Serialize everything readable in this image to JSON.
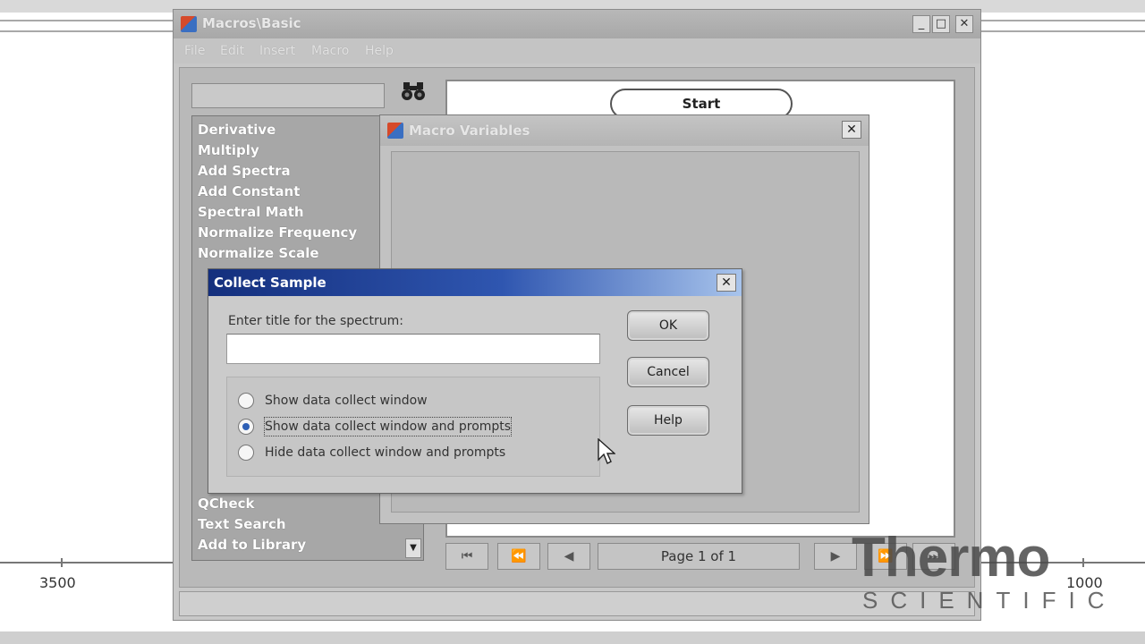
{
  "background": {
    "axis_labels": [
      "3500",
      "1000"
    ]
  },
  "main_window": {
    "title": "Macros\\Basic",
    "controls": {
      "minimize": "_",
      "maximize": "□",
      "close": "✕"
    },
    "menu": [
      "File",
      "Edit",
      "Insert",
      "Macro",
      "Help"
    ],
    "commands": [
      "Derivative",
      "Multiply",
      "Add Spectra",
      "Add Constant",
      "Spectral Math",
      "Normalize Frequency",
      "Normalize Scale",
      "QCheck",
      "Text Search",
      "Add to Library"
    ],
    "flow_start": "Start",
    "pager": {
      "first": "⏮",
      "prev_fast": "⏪",
      "prev": "◀",
      "page_label": "Page 1 of 1",
      "next": "▶",
      "next_fast": "⏩",
      "last": "⏭"
    }
  },
  "macro_variables": {
    "title": "Macro Variables",
    "close": "✕"
  },
  "collect_sample": {
    "title": "Collect Sample",
    "close": "✕",
    "prompt": "Enter title for the spectrum:",
    "title_value": "",
    "options": [
      {
        "label": "Show data collect window",
        "checked": false
      },
      {
        "label": "Show data collect window and prompts",
        "checked": true
      },
      {
        "label": "Hide data collect window and prompts",
        "checked": false
      }
    ],
    "buttons": {
      "ok": "OK",
      "cancel": "Cancel",
      "help": "Help"
    }
  },
  "logo": {
    "main": "Thermo",
    "sub": "SCIENTIFIC"
  }
}
